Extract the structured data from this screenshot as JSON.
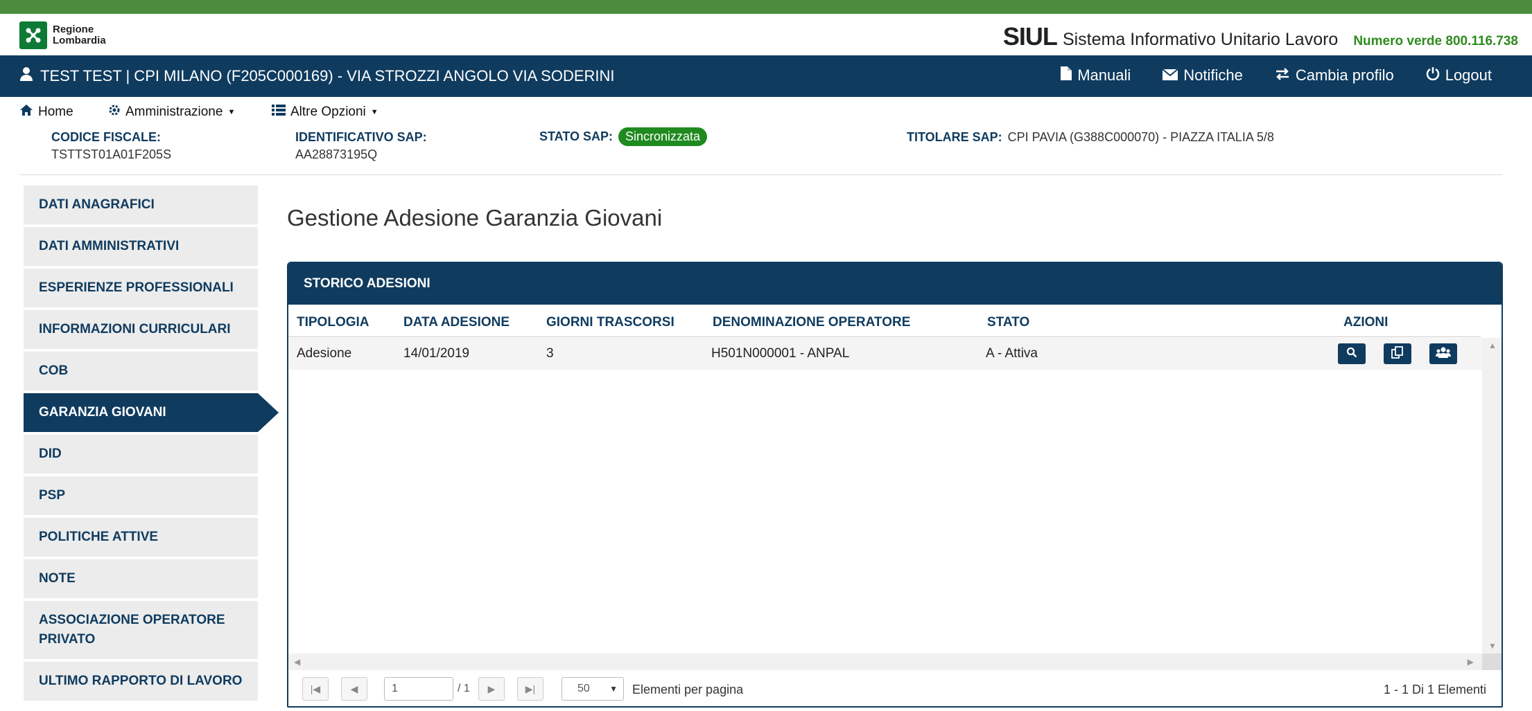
{
  "header": {
    "logo_line1": "Regione",
    "logo_line2": "Lombardia",
    "app_short": "SIUL",
    "app_full": "Sistema Informativo Unitario Lavoro",
    "phone": "Numero verde 800.116.738"
  },
  "userbar": {
    "user_text": "TEST TEST | CPI MILANO (F205C000169) - VIA STROZZI ANGOLO VIA SODERINI",
    "links": {
      "manuali": "Manuali",
      "notifiche": "Notifiche",
      "cambia_profilo": "Cambia profilo",
      "logout": "Logout"
    }
  },
  "menu": {
    "home": "Home",
    "amministrazione": "Amministrazione",
    "altre_opzioni": "Altre Opzioni"
  },
  "sap": {
    "codice_fiscale_label": "CODICE FISCALE:",
    "codice_fiscale_value": "TSTTST01A01F205S",
    "identificativo_label": "IDENTIFICATIVO SAP:",
    "identificativo_value": "AA28873195Q",
    "stato_label": "STATO SAP:",
    "stato_value": "Sincronizzata",
    "titolare_label": "TITOLARE SAP:",
    "titolare_value": "CPI PAVIA (G388C000070) - PIAZZA ITALIA 5/8"
  },
  "sidebar": {
    "items": [
      {
        "label": "DATI ANAGRAFICI"
      },
      {
        "label": "DATI AMMINISTRATIVI"
      },
      {
        "label": "ESPERIENZE PROFESSIONALI"
      },
      {
        "label": "INFORMAZIONI CURRICULARI"
      },
      {
        "label": "COB"
      },
      {
        "label": "GARANZIA GIOVANI"
      },
      {
        "label": "DID"
      },
      {
        "label": "PSP"
      },
      {
        "label": "POLITICHE ATTIVE"
      },
      {
        "label": "NOTE"
      },
      {
        "label": "ASSOCIAZIONE OPERATORE PRIVATO"
      },
      {
        "label": "ULTIMO RAPPORTO DI LAVORO"
      }
    ],
    "active": "GARANZIA GIOVANI"
  },
  "main": {
    "title": "Gestione Adesione Garanzia Giovani",
    "panel_title": "STORICO ADESIONI",
    "columns": [
      "TIPOLOGIA",
      "DATA ADESIONE",
      "GIORNI TRASCORSI",
      "DENOMINAZIONE OPERATORE",
      "STATO",
      "AZIONI"
    ],
    "rows": [
      {
        "tipologia": "Adesione",
        "data_adesione": "14/01/2019",
        "giorni": "3",
        "operatore": "H501N000001 - ANPAL",
        "stato": "A - Attiva"
      }
    ]
  },
  "pager": {
    "page": "1",
    "of_text": "/ 1",
    "page_size": "50",
    "page_size_label": "Elementi per pagina",
    "summary": "1 - 1 Di 1 Elementi"
  },
  "colors": {
    "primary": "#0f3b5f",
    "top_strip": "#4c8c3e",
    "badge": "#1f8a1f",
    "phone": "#2e8b1e"
  },
  "icons": {
    "user": "user-icon",
    "manuali": "file-icon",
    "notifiche": "envelope-icon",
    "cambia_profilo": "swap-icon",
    "logout": "power-icon",
    "home": "home-icon",
    "amministrazione": "gear-icon",
    "altre_opzioni": "list-icon",
    "actions": [
      "search-icon",
      "copy-icon",
      "users-icon"
    ]
  }
}
